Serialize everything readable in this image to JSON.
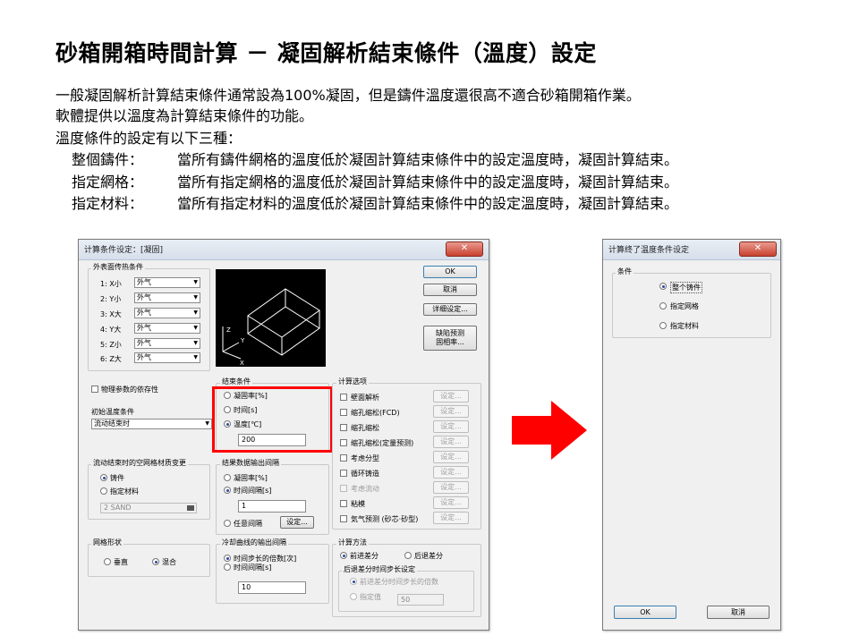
{
  "slide": {
    "title": "砂箱開箱時間計算 － 凝固解析結束條件（溫度）設定",
    "lines": [
      "一般凝固解析計算結束條件通常設為100%凝固，但是鑄件溫度還很高不適合砂箱開箱作業。",
      "軟體提供以溫度為計算結束條件的功能。",
      "溫度條件的設定有以下三種："
    ],
    "options": [
      {
        "label": "整個鑄件：",
        "desc": "當所有鑄件網格的溫度低於凝固計算結束條件中的設定溫度時，凝固計算結束。"
      },
      {
        "label": "指定網格：",
        "desc": "當所有指定網格的溫度低於凝固計算結束條件中的設定溫度時，凝固計算結束。"
      },
      {
        "label": "指定材料：",
        "desc": "當所有指定材料的溫度低於凝固計算結束條件中的設定溫度時，凝固計算結束。"
      }
    ],
    "arrow_color": "#ff0000"
  },
  "dialog1": {
    "title": "计算条件设定：[凝固]",
    "close": "✕",
    "surface_group": "外表面传热条件",
    "surfaces": [
      {
        "label": "1: X小",
        "value": "外气"
      },
      {
        "label": "2: Y小",
        "value": "外气"
      },
      {
        "label": "3: X大",
        "value": "外气"
      },
      {
        "label": "4: Y大",
        "value": "外气"
      },
      {
        "label": "5: Z小",
        "value": "外气"
      },
      {
        "label": "6: Z大",
        "value": "外气"
      }
    ],
    "axis": {
      "z": "Z",
      "y": "Y",
      "x": "X"
    },
    "buttons": {
      "ok": "OK",
      "cancel": "取消",
      "detail": "详细设定...",
      "defect": "缺陷预测\n固相率..."
    },
    "temp_dependency": "物理参数的依存性",
    "init_temp_label": "初始温度条件",
    "init_temp_value": "流动结束时",
    "end_cond": {
      "title": "结束条件",
      "options": [
        "凝固率[%]",
        "时间[s]",
        "温度[℃]"
      ],
      "selected": 2,
      "value": "200"
    },
    "calc_options": {
      "title": "计算选项",
      "items": [
        "壁面解析",
        "缩孔缩松(FCD)",
        "缩孔缩松",
        "缩孔缩松(定量预测)",
        "考虑分型",
        "循环铸造",
        "考虑流动",
        "粘模",
        "気气预测 (砂芯·砂型)"
      ],
      "setting": "设定..."
    },
    "mesh_change": {
      "title": "流动结束时的空网格材质变更",
      "options": [
        "铸件",
        "指定材料"
      ],
      "material": "2 SAND"
    },
    "output_interval": {
      "title": "结果数据输出间隔",
      "options": [
        "凝固率[%]",
        "时间间隔[s]",
        "任意间隔"
      ],
      "value": "1",
      "setting": "设定..."
    },
    "mesh_shape": {
      "title": "网格形状",
      "options": [
        "垂直",
        "混合"
      ]
    },
    "cooling_output": {
      "title": "冷却曲线的输出间隔",
      "options": [
        "时间步长的倍数[次]",
        "时间间隔[s]"
      ],
      "value": "10"
    },
    "calc_method": {
      "title": "计算方法",
      "options": [
        "前进差分",
        "后退差分"
      ],
      "sub_title": "后退差分时间步长设定",
      "sub_options": [
        "前进差分时间步长的倍数",
        "指定值"
      ],
      "sub_value": "50"
    }
  },
  "dialog2": {
    "title": "计算终了温度条件设定",
    "close": "✕",
    "group": "条件",
    "options": [
      "整个铸件",
      "指定网格",
      "指定材料"
    ],
    "selected": 0,
    "ok": "OK",
    "cancel": "取消"
  }
}
